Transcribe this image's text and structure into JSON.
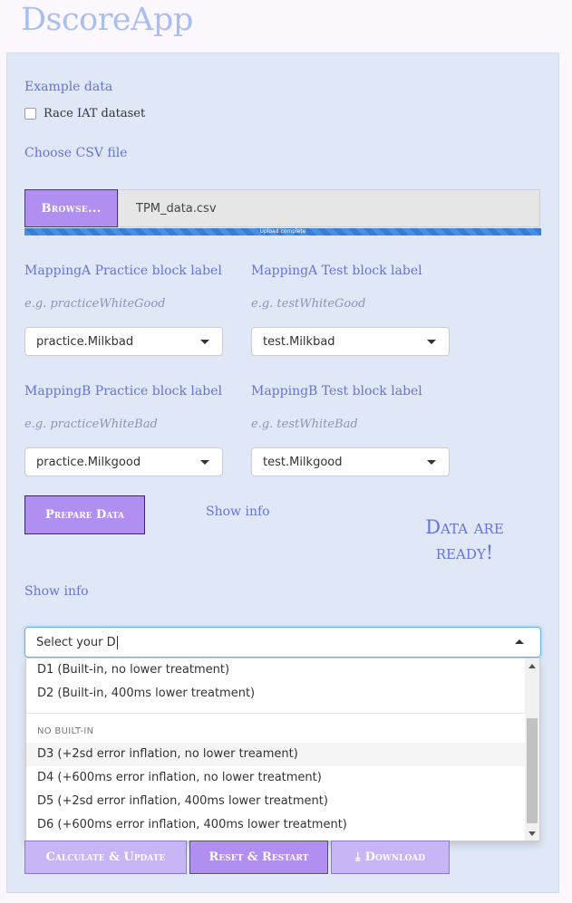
{
  "app": {
    "title": "DscoreApp"
  },
  "example": {
    "label": "Example data",
    "checkbox_label": "Race IAT dataset"
  },
  "file": {
    "label": "Choose CSV file",
    "browse_label": "Browse...",
    "filename": "TPM_data.csv",
    "progress_text": "Upload complete",
    "progress": 1.0
  },
  "mappingA": {
    "practice": {
      "label": "MappingA Practice block label",
      "hint": "e.g. practiceWhiteGood",
      "value": "practice.Milkbad"
    },
    "test": {
      "label": "MappingA Test block label",
      "hint": "e.g. testWhiteGood",
      "value": "test.Milkbad"
    }
  },
  "mappingB": {
    "practice": {
      "label": "MappingB Practice block label",
      "hint": "e.g. practiceWhiteBad",
      "value": "practice.Milkgood"
    },
    "test": {
      "label": "MappingB Test block label",
      "hint": "e.g. testWhiteBad",
      "value": "test.Milkgood"
    }
  },
  "prepare": {
    "button_label": "Prepare Data",
    "show_info": "Show info",
    "ready_line1": "Data are",
    "ready_line2": "ready!"
  },
  "dscore": {
    "show_info": "Show info",
    "input_value": "Select your D",
    "options": [
      "D1 (Built-in, no lower treatment)",
      "D2 (Built-in, 400ms lower treatment)",
      "D3 (+2sd error inflation, no lower treament)",
      "D4 (+600ms error inflation, no lower treatment)",
      "D5 (+2sd error inflation, 400ms lower treatment)",
      "D6 (+600ms error inflation, 400ms lower treatment)"
    ],
    "group_header": "NO BUILT-IN"
  },
  "buttons": {
    "calculate": "Calculate & Update",
    "reset": "Reset & Restart",
    "download": "Download"
  },
  "colors": {
    "accent": "#b08ff0",
    "label": "#6673d9",
    "panel": "#e0e8f7",
    "progress": "#4a90e2"
  },
  "icons": {
    "download": "download-icon",
    "caret": "chevron-down-icon"
  }
}
